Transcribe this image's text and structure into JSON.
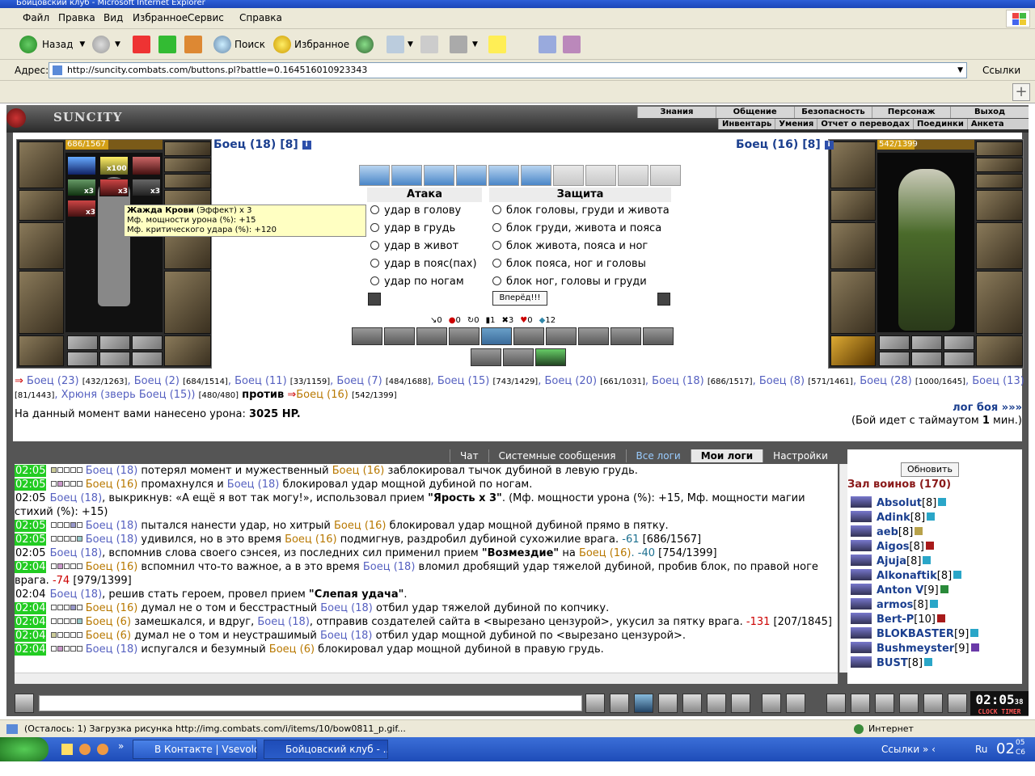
{
  "window": {
    "title": "Бойцовский клуб - Microsoft Internet Explorer"
  },
  "menu": [
    "Файл",
    "Правка",
    "Вид",
    "Избранное",
    "Сервис",
    "Справка"
  ],
  "toolbar": {
    "back_label": "Назад",
    "search_label": "Поиск",
    "favorites_label": "Избранное"
  },
  "address": {
    "label": "Адрес:",
    "url": "http://suncity.combats.com/buttons.pl?battle=0.164516010923343",
    "links_label": "Ссылки"
  },
  "game_header": {
    "logo": "SUNCITY",
    "nav_top": [
      "Знания",
      "Общение",
      "Безопасность",
      "Персонаж",
      "Выход"
    ],
    "nav_bottom": [
      "Инвентарь",
      "Умения",
      "Отчет о переводах",
      "Поединки",
      "Анкета"
    ]
  },
  "left_fighter": {
    "name": "Боец (18) [8]",
    "info": "i",
    "hp_text": "686/1567",
    "hp_fraction": 0.438,
    "counts": [
      "x100",
      "x3",
      "x3",
      "x3",
      "x3"
    ]
  },
  "right_fighter": {
    "name": "Боец (16) [8]",
    "info": "i",
    "hp_text": "542/1399",
    "hp_fraction": 0.387
  },
  "tooltip": {
    "title": "Жажда Крови",
    "title_suffix": " (Эффект) x 3",
    "line1": "Мф. мощности урона (%): +15",
    "line2": "Мф. критического удара (%): +120"
  },
  "combat": {
    "attack_header": "Атака",
    "defense_header": "Защита",
    "attacks": [
      "удар в голову",
      "удар в грудь",
      "удар в живот",
      "удар в пояс(пах)",
      "удар по ногам"
    ],
    "defenses": [
      "блок головы, груди и живота",
      "блок груди, живота и пояса",
      "блок живота, пояса и ног",
      "блок пояса, ног и головы",
      "блок ног, головы и груди"
    ],
    "go_button": "Вперёд!!!",
    "stats": [
      "0",
      "0",
      "0",
      "1",
      "3",
      "0",
      "12"
    ]
  },
  "teams": {
    "left": [
      {
        "name": "Боец (23)",
        "hp": "[432/1263]"
      },
      {
        "name": "Боец (2)",
        "hp": "[684/1514]"
      },
      {
        "name": "Боец (11)",
        "hp": "[33/1159]"
      },
      {
        "name": "Боец (7)",
        "hp": "[484/1688]"
      },
      {
        "name": "Боец (15)",
        "hp": "[743/1429]"
      },
      {
        "name": "Боец (20)",
        "hp": "[661/1031]"
      },
      {
        "name": "Боец (18)",
        "hp": "[686/1517]"
      },
      {
        "name": "Боец (8)",
        "hp": "[571/1461]"
      },
      {
        "name": "Боец (28)",
        "hp": "[1000/1645]"
      },
      {
        "name": "Боец (13)",
        "hp": "[81/1443]"
      },
      {
        "name": "Хрюня (зверь Боец (15))",
        "hp": "[480/480]"
      }
    ],
    "versus": "против",
    "right": {
      "name": "Боец (16)",
      "hp": "[542/1399]"
    }
  },
  "damage": {
    "prefix": "На данный момент вами нанесено урона: ",
    "value": "3025 HP."
  },
  "battle_log_link": "лог боя »»»",
  "timeout_prefix": "(Бой идет с таймаутом ",
  "timeout_value": "1",
  "timeout_suffix": " мин.)",
  "chat_tabs": [
    "Чат",
    "Системные сообщения",
    "Все логи",
    "Мои логи",
    "Настройки"
  ],
  "log": [
    {
      "t": "02:05",
      "a": "Боец (18)",
      "m1": " потерял момент и мужественный ",
      "b": "Боец (16)",
      "m2": " заблокировал тычок дубиной в левую грудь."
    },
    {
      "t": "02:05",
      "a": "Боец (16)",
      "m1": " промахнулся и ",
      "b": "Боец (18)",
      "m2": " блокировал удар мощной дубиной по ногам."
    },
    {
      "t": "02:05",
      "a": "Боец (18)",
      "m1": ", выкрикнув: «А ещё я вот так могу!», использовал прием ",
      "s": "\"Ярость x 3\"",
      "m2": ". (Мф. мощности урона (%): +15, Мф. мощности магии стихий (%): +15)"
    },
    {
      "t": "02:05",
      "a": "Боец (18)",
      "m1": " пытался нанести удар, но хитрый ",
      "b": "Боец (16)",
      "m2": " блокировал удар мощной дубиной прямо в пятку."
    },
    {
      "t": "02:05",
      "a": "Боец (18)",
      "m1": " удивился, но в это время ",
      "b": "Боец (16)",
      "m2": " подмигнув, раздробил дубиной сухожилие врага. ",
      "d": "-61",
      "h": " [686/1567]"
    },
    {
      "t": "02:05",
      "a": "Боец (18)",
      "m1": ", вспомнив слова своего сэнсея, из последних сил применил прием ",
      "s": "\"Возмездие\"",
      "m2": " на ",
      "b": "Боец (16)",
      "d": ". -40",
      "h": " [754/1399]"
    },
    {
      "t": "02:04",
      "a": "Боец (16)",
      "m1": " вспомнил что-то важное, а в это время ",
      "b": "Боец (18)",
      "m2": " вломил дробящий удар тяжелой дубиной, пробив блок, по правой ноге врага. ",
      "d": "-74",
      "h": " [979/1399]"
    },
    {
      "t": "02:04",
      "a": "Боец (18)",
      "m1": ", решив стать героем, провел прием ",
      "s": "\"Слепая удача\"",
      "m2": "."
    },
    {
      "t": "02:04",
      "a": "Боец (16)",
      "m1": " думал не о том и бесстрастный ",
      "b": "Боец (18)",
      "m2": " отбил удар тяжелой дубиной по копчику."
    },
    {
      "t": "02:04",
      "a": "Боец (6)",
      "m1": " замешкался, и вдруг, ",
      "b": "Боец (18)",
      "m2": ", отправив создателей сайта в <вырезано цензурой>, укусил за пятку врага. ",
      "d": "-131",
      "h": " [207/1845]"
    },
    {
      "t": "02:04",
      "a": "Боец (6)",
      "m1": " думал не о том и неустрашимый ",
      "b": "Боец (18)",
      "m2": " отбил удар мощной дубиной по <вырезано цензурой>."
    },
    {
      "t": "02:04",
      "a": "Боец (18)",
      "m1": " испугался и безумный ",
      "b": "Боец (6)",
      "m2": " блокировал удар мощной дубиной в правую грудь."
    }
  ],
  "side": {
    "refresh": "Обновить",
    "hall": "Зал воинов (170)",
    "players": [
      {
        "name": "Absolut",
        "lvl": "[8]",
        "c": "#2aa6c8"
      },
      {
        "name": "Adink",
        "lvl": "[8]",
        "c": "#2aa6c8"
      },
      {
        "name": "aeb",
        "lvl": "[8]",
        "c": "#b8a24a"
      },
      {
        "name": "Aigos",
        "lvl": "[8]",
        "c": "#a81a1a"
      },
      {
        "name": "Ajuja",
        "lvl": "[8]",
        "c": "#2aa6c8"
      },
      {
        "name": "Alkonaftik",
        "lvl": "[8]",
        "c": "#2aa6c8"
      },
      {
        "name": "Anton V",
        "lvl": "[9]",
        "c": "#2a8a3a"
      },
      {
        "name": "armos",
        "lvl": "[8]",
        "c": "#2aa6c8"
      },
      {
        "name": "Bert-P",
        "lvl": "[10]",
        "c": "#a81a1a"
      },
      {
        "name": "BLOKBASTER",
        "lvl": "[9]",
        "c": "#2aa6c8"
      },
      {
        "name": "Bushmeyster",
        "lvl": "[9]",
        "c": "#6a3aa8"
      },
      {
        "name": "BUST",
        "lvl": "[8]",
        "c": "#2aa6c8"
      }
    ]
  },
  "clock": {
    "time": "02:05",
    "sec": "38",
    "sub": "CLOCK TIMER"
  },
  "status": {
    "message": "(Осталось: 1) Загрузка рисунка http://img.combats.com/i/items/10/bow0811_p.gif...",
    "zone": "Интернет"
  },
  "taskbar": {
    "tasks": [
      "В Контакте | Vsevolo...",
      "Бойцовский клуб - ..."
    ],
    "links": "Ссылки",
    "lang": "Ru",
    "time": "02",
    "time_small": "05",
    "time_small2": "С6"
  },
  "colors": {
    "link": "#5560c0",
    "enemy": "#b87800",
    "damage": "#c00000",
    "time_bg": "#22cc22"
  }
}
